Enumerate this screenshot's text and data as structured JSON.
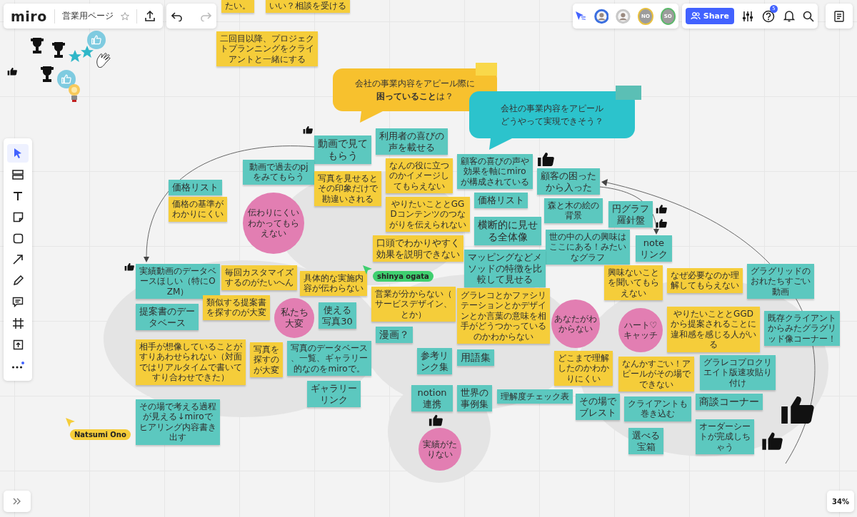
{
  "header": {
    "logo": "miro",
    "board_title": "営業用ページ",
    "starred": false
  },
  "collaborators": [
    {
      "kind": "photo",
      "color": "#3b6fe0"
    },
    {
      "kind": "photo",
      "color": "#c8c8c8"
    },
    {
      "kind": "initials",
      "initials": "NO",
      "color": "#e8c040"
    },
    {
      "kind": "initials",
      "initials": "SO",
      "color": "#5bb86a"
    }
  ],
  "share_button": "Share",
  "help_badge": "5",
  "zoom_level": "34%",
  "tools": [
    {
      "kind": "select",
      "selected": true
    },
    {
      "kind": "templates",
      "selected": false
    },
    {
      "kind": "text",
      "selected": false
    },
    {
      "kind": "sticky",
      "selected": false
    },
    {
      "kind": "shape",
      "selected": false
    },
    {
      "kind": "connector",
      "selected": false
    },
    {
      "kind": "pen",
      "selected": false
    },
    {
      "kind": "comment",
      "selected": false
    },
    {
      "kind": "frame",
      "selected": false
    },
    {
      "kind": "upload",
      "selected": false
    },
    {
      "kind": "more",
      "selected": false
    }
  ],
  "prompts": [
    {
      "text": "会社の事業内容をアピール際に**困っていること**は？",
      "color": "#f7c12e"
    },
    {
      "text": "会社の事業内容をアピールどうやって実現できそう？",
      "color": "#2cc3cc"
    }
  ],
  "notes": [
    {
      "kind": "sticky",
      "color": "#f5cd3a",
      "text": "たい。"
    },
    {
      "kind": "sticky",
      "color": "#f5cd3a",
      "text": "いい？相談を受ける"
    },
    {
      "kind": "sticky",
      "color": "#f5cd3a",
      "text": "二回目以降、プロジェクトプランニングをクライアントと一緒にする"
    },
    {
      "kind": "sticky",
      "color": "#5cc8bf",
      "text": "動画で見てもらう"
    },
    {
      "kind": "sticky",
      "color": "#5cc8bf",
      "text": "利用者の喜びの声を載せる"
    },
    {
      "kind": "sticky",
      "color": "#5cc8bf",
      "text": "動画で過去のpjをみてもらう"
    },
    {
      "kind": "sticky",
      "color": "#5cc8bf",
      "text": "価格リスト"
    },
    {
      "kind": "sticky",
      "color": "#f5cd3a",
      "text": "写真を見せるとその印象だけで勘違いされる"
    },
    {
      "kind": "sticky",
      "color": "#f5cd3a",
      "text": "なんの役に立つのかイメージしてもらえない"
    },
    {
      "kind": "sticky",
      "color": "#5cc8bf",
      "text": "顧客の喜びの声や効果を軸にmiroが構成されている"
    },
    {
      "kind": "sticky",
      "color": "#5cc8bf",
      "text": "顧客の困ったから入った"
    },
    {
      "kind": "sticky",
      "color": "#f5cd3a",
      "text": "価格の基準がわかりにくい"
    },
    {
      "kind": "circle",
      "color": "#e27eb2",
      "text": "伝わりにくいわかってもらえない"
    },
    {
      "kind": "sticky",
      "color": "#f5cd3a",
      "text": "やりたいこととGGDコンテンツのつながりを伝えられない"
    },
    {
      "kind": "sticky",
      "color": "#5cc8bf",
      "text": "価格リスト"
    },
    {
      "kind": "sticky",
      "color": "#5cc8bf",
      "text": "森と木の絵の背景"
    },
    {
      "kind": "sticky",
      "color": "#5cc8bf",
      "text": "円グラフ羅針盤"
    },
    {
      "kind": "sticky",
      "color": "#5cc8bf",
      "text": "横断的に見せる全体像"
    },
    {
      "kind": "sticky",
      "color": "#f5cd3a",
      "text": "口頭でわかりやすく効果を説明できない"
    },
    {
      "kind": "sticky",
      "color": "#5cc8bf",
      "text": "世の中の人の興味はここにある！みたいなグラフ"
    },
    {
      "kind": "sticky",
      "color": "#5cc8bf",
      "text": "noteリンク"
    },
    {
      "kind": "sticky",
      "color": "#5cc8bf",
      "text": "実績動画のデータベースほしい（特にOZM）"
    },
    {
      "kind": "sticky",
      "color": "#f5cd3a",
      "text": "毎回カスタマイズするのがたいへん"
    },
    {
      "kind": "sticky",
      "color": "#f5cd3a",
      "text": "具体的な実施内容が伝わらない"
    },
    {
      "kind": "sticky",
      "color": "#5cc8bf",
      "text": "マッピングなどメソッドの特徴を比較して見せる"
    },
    {
      "kind": "sticky",
      "color": "#f5cd3a",
      "text": "興味ないことを聞いてもらえない"
    },
    {
      "kind": "sticky",
      "color": "#f5cd3a",
      "text": "なぜ必要なのか理解してもらえない"
    },
    {
      "kind": "sticky",
      "color": "#5cc8bf",
      "text": "グラグリッドのおれたちすごい動画"
    },
    {
      "kind": "sticky",
      "color": "#5cc8bf",
      "text": "提案書のデータベース"
    },
    {
      "kind": "sticky",
      "color": "#f5cd3a",
      "text": "類似する提案書を探すのが大変"
    },
    {
      "kind": "circle",
      "color": "#e27eb2",
      "text": "私たち大変"
    },
    {
      "kind": "sticky",
      "color": "#5cc8bf",
      "text": "使える写真30"
    },
    {
      "kind": "sticky",
      "color": "#f5cd3a",
      "text": "営業が分からない（サービスデザイン、とか）"
    },
    {
      "kind": "sticky",
      "color": "#5cc8bf",
      "text": "漫画？"
    },
    {
      "kind": "sticky",
      "color": "#f5cd3a",
      "text": "グラレコとかファシリテーションとかデザインとか言葉の意味を相手がどうつかっているのかわからない"
    },
    {
      "kind": "circle",
      "color": "#e27eb2",
      "text": "あなたがわからない"
    },
    {
      "kind": "circle",
      "color": "#e27eb2",
      "text": "ハート♡キャッチ"
    },
    {
      "kind": "sticky",
      "color": "#f5cd3a",
      "text": "やりたいこととGGDから提案されることに違和感を感じる人がいる"
    },
    {
      "kind": "sticky",
      "color": "#5cc8bf",
      "text": "既存クライアントからみたグラグリッド像コーナー！"
    },
    {
      "kind": "sticky",
      "color": "#f5cd3a",
      "text": "相手が想像していることがすりあわせられない（対面ではリアルタイムで書いてすり合わせできた）"
    },
    {
      "kind": "sticky",
      "color": "#f5cd3a",
      "text": "写真を探すのが大変"
    },
    {
      "kind": "sticky",
      "color": "#5cc8bf",
      "text": "写真のデータベース、一覧、ギャラリー的なのをmiroで。"
    },
    {
      "kind": "sticky",
      "color": "#5cc8bf",
      "text": "参考リンク集"
    },
    {
      "kind": "sticky",
      "color": "#5cc8bf",
      "text": "用語集"
    },
    {
      "kind": "sticky",
      "color": "#f5cd3a",
      "text": "どこまで理解したのかわかりにくい"
    },
    {
      "kind": "sticky",
      "color": "#f5cd3a",
      "text": "なんかすごい！アピールがその場でできない"
    },
    {
      "kind": "sticky",
      "color": "#5cc8bf",
      "text": "グラレコプロクリエイト版速攻貼り付け"
    },
    {
      "kind": "sticky",
      "color": "#5cc8bf",
      "text": "ギャラリーリンク"
    },
    {
      "kind": "sticky",
      "color": "#5cc8bf",
      "text": "notion連携"
    },
    {
      "kind": "sticky",
      "color": "#5cc8bf",
      "text": "世界の事例集"
    },
    {
      "kind": "sticky",
      "color": "#5cc8bf",
      "text": "理解度チェック表"
    },
    {
      "kind": "sticky",
      "color": "#5cc8bf",
      "text": "その場で考える過程が見える↓miroでヒアリング内容書き出す"
    },
    {
      "kind": "sticky",
      "color": "#5cc8bf",
      "text": "その場でブレスト"
    },
    {
      "kind": "sticky",
      "color": "#5cc8bf",
      "text": "クライアントも巻き込む"
    },
    {
      "kind": "sticky",
      "color": "#5cc8bf",
      "text": "商談コーナー"
    },
    {
      "kind": "circle",
      "color": "#e27eb2",
      "text": "実績がたりない"
    },
    {
      "kind": "sticky",
      "color": "#5cc8bf",
      "text": "選べる宝箱"
    },
    {
      "kind": "sticky",
      "color": "#5cc8bf",
      "text": "オーダーシートが完成しちゃう"
    }
  ],
  "cursors": [
    {
      "name": "shinya ogata",
      "color": "#3fcf6f"
    },
    {
      "name": "Natsumi Ono",
      "color": "#f5cd3a"
    }
  ]
}
